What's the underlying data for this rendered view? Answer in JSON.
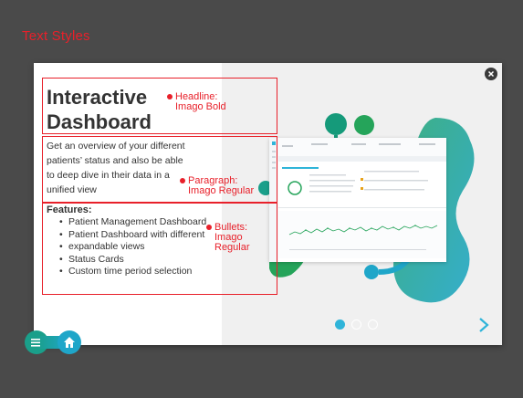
{
  "page": {
    "heading": "Text Styles"
  },
  "slide": {
    "headline": [
      "Interactive",
      "Dashboard"
    ],
    "paragraph": [
      "Get an overview of your different",
      "patients’ status and also be able",
      "to deep dive in their data in a",
      "unified view"
    ],
    "features_title": "Features:",
    "bullets": [
      "Patient Management Dashboard",
      "Patient Dashboard with different",
      "expandable views",
      "Status Cards",
      "Custom time period selection"
    ],
    "annotations": {
      "headline": [
        "Headline:",
        "Imago Bold"
      ],
      "paragraph": [
        "Paragraph:",
        "Imago Regular"
      ],
      "bullets": [
        "Bullets:",
        "Imago",
        "Regular"
      ]
    }
  },
  "carousel": {
    "current": 1,
    "total": 3
  },
  "icons": {
    "close": "close-icon",
    "next": "chevron-right-icon",
    "menu": "hamburger-menu-icon",
    "home": "home-icon"
  },
  "colors": {
    "background": "#4a4a4a",
    "accent_red": "#e8202a",
    "teal": "#1a9f8a",
    "cyan": "#2fb4d9",
    "green": "#25a45a"
  }
}
